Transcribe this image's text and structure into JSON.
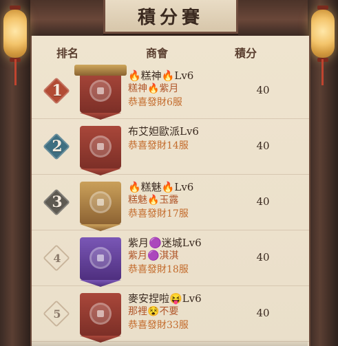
{
  "title": "積分賽",
  "columns": {
    "rank": "排名",
    "guild": "商會",
    "score": "積分"
  },
  "rows": [
    {
      "rank": "1",
      "line1": "🔥糕神🔥Lv6",
      "line2": "糕神🔥紫月",
      "line3": "恭喜發財6服",
      "score": "40",
      "banner": "red-topper"
    },
    {
      "rank": "2",
      "line1": "布艾妲歐派Lv6",
      "line2": "",
      "line3": "恭喜發財14服",
      "score": "40",
      "banner": "red"
    },
    {
      "rank": "3",
      "line1": "🔥糕魅🔥Lv6",
      "line2": "糕魅🔥玉露",
      "line3": "恭喜發財17服",
      "score": "40",
      "banner": "gold"
    },
    {
      "rank": "4",
      "line1": "紫月🟣迷城Lv6",
      "line2": "紫月🟣淇淇",
      "line3": "恭喜發財18服",
      "score": "40",
      "banner": "purple"
    },
    {
      "rank": "5",
      "line1": "麥安捏啦😝Lv6",
      "line2": "那裡😵不要",
      "line3": "恭喜發財33服",
      "score": "40",
      "banner": "red"
    }
  ]
}
